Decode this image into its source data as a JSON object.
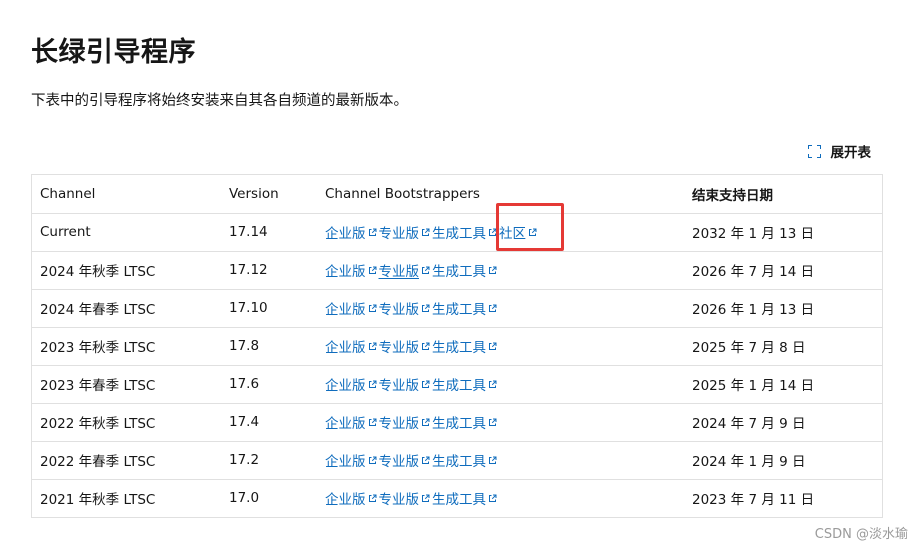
{
  "title": "长绿引导程序",
  "description": "下表中的引导程序将始终安装来自其各自频道的最新版本。",
  "expand_label": "展开表",
  "table": {
    "headers": [
      "Channel",
      "Version",
      "Channel Bootstrappers",
      "结束支持日期"
    ],
    "rows": [
      {
        "channel": "Current",
        "version": "17.14",
        "links": [
          "企业版",
          "专业版",
          "生成工具",
          "社区"
        ],
        "end": "2032 年 1 月 13 日"
      },
      {
        "channel": "2024 年秋季 LTSC",
        "version": "17.12",
        "links": [
          "企业版",
          "专业版",
          "生成工具"
        ],
        "end": "2026 年 7 月 14 日"
      },
      {
        "channel": "2024 年春季 LTSC",
        "version": "17.10",
        "links": [
          "企业版",
          "专业版",
          "生成工具"
        ],
        "end": "2026 年 1 月 13 日"
      },
      {
        "channel": "2023 年秋季 LTSC",
        "version": "17.8",
        "links": [
          "企业版",
          "专业版",
          "生成工具"
        ],
        "end": "2025 年 7 月 8 日"
      },
      {
        "channel": "2023 年春季 LTSC",
        "version": "17.6",
        "links": [
          "企业版",
          "专业版",
          "生成工具"
        ],
        "end": "2025 年 1 月 14 日"
      },
      {
        "channel": "2022 年秋季 LTSC",
        "version": "17.4",
        "links": [
          "企业版",
          "专业版",
          "生成工具"
        ],
        "end": "2024 年 7 月 9 日"
      },
      {
        "channel": "2022 年春季 LTSC",
        "version": "17.2",
        "links": [
          "企业版",
          "专业版",
          "生成工具"
        ],
        "end": "2024 年 1 月 9 日"
      },
      {
        "channel": "2021 年秋季 LTSC",
        "version": "17.0",
        "links": [
          "企业版",
          "专业版",
          "生成工具"
        ],
        "end": "2023 年 7 月 11 日"
      }
    ]
  },
  "watermark": "CSDN @淡水瑜",
  "colors": {
    "link": "#0f6cbd",
    "highlight": "#e53935",
    "border": "#e0e0e0"
  }
}
